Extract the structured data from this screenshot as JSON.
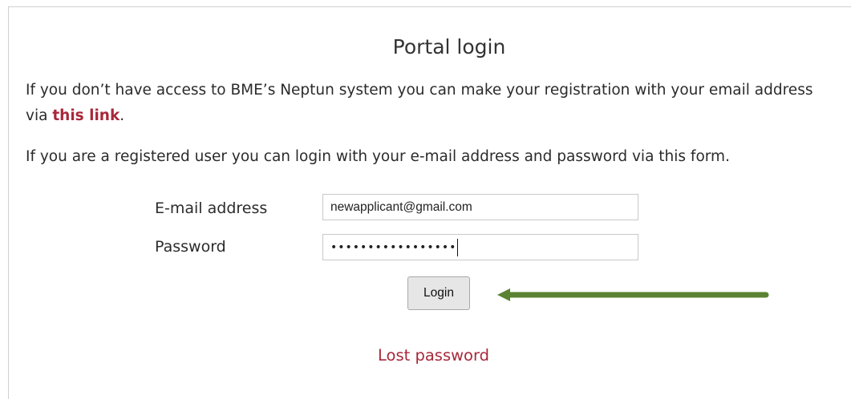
{
  "title": "Portal login",
  "intro": {
    "before_link": "If you don’t have access to BME’s Neptun system you can make your registration with your email address via ",
    "link_label": "this link",
    "after_link": "."
  },
  "registered_text": "If you are a registered user you can login with your e-mail address and password via this form.",
  "form": {
    "email_label": "E-mail address",
    "email_value": "newapplicant@gmail.com",
    "password_label": "Password",
    "password_masked": "•••••••••••••••••",
    "login_label": "Login"
  },
  "lost_password_label": "Lost password",
  "colors": {
    "link": "#a8283a",
    "arrow": "#5a8233"
  },
  "annotations": {
    "arrow": "arrow-left-icon"
  }
}
